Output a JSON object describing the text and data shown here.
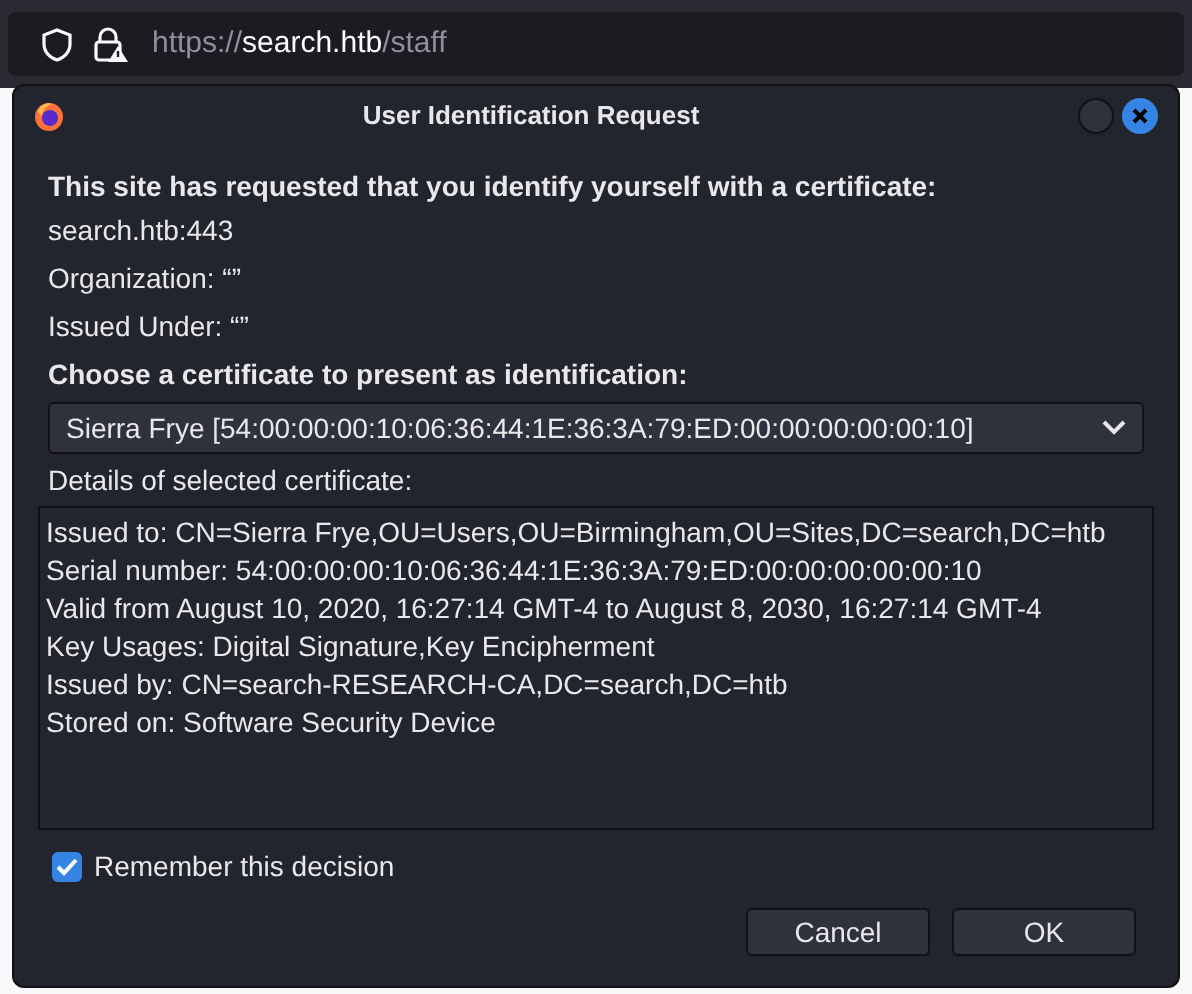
{
  "address_bar": {
    "url_scheme": "https://",
    "url_host": "search.htb",
    "url_path": "/staff"
  },
  "dialog": {
    "title": "User Identification Request",
    "heading": "This site has requested that you identify yourself with a certificate:",
    "info_lines": [
      "search.htb:443",
      "Organization: “”",
      "Issued Under: “”"
    ],
    "choose_label": "Choose a certificate to present as identification:",
    "certificate_select": {
      "value": "Sierra Frye [54:00:00:00:10:06:36:44:1E:36:3A:79:ED:00:00:00:00:00:10]"
    },
    "details_label": "Details of selected certificate:",
    "details_lines": [
      "Issued to: CN=Sierra Frye,OU=Users,OU=Birmingham,OU=Sites,DC=search,DC=htb",
      "Serial number: 54:00:00:00:10:06:36:44:1E:36:3A:79:ED:00:00:00:00:00:10",
      "Valid from August 10, 2020, 16:27:14 GMT-4 to August 8, 2030, 16:27:14 GMT-4",
      "Key Usages: Digital Signature,Key Encipherment",
      "Issued by: CN=search-RESEARCH-CA,DC=search,DC=htb",
      "Stored on: Software Security Device"
    ],
    "remember": {
      "label": "Remember this decision",
      "checked": true
    },
    "buttons": [
      "Cancel",
      "OK"
    ]
  }
}
